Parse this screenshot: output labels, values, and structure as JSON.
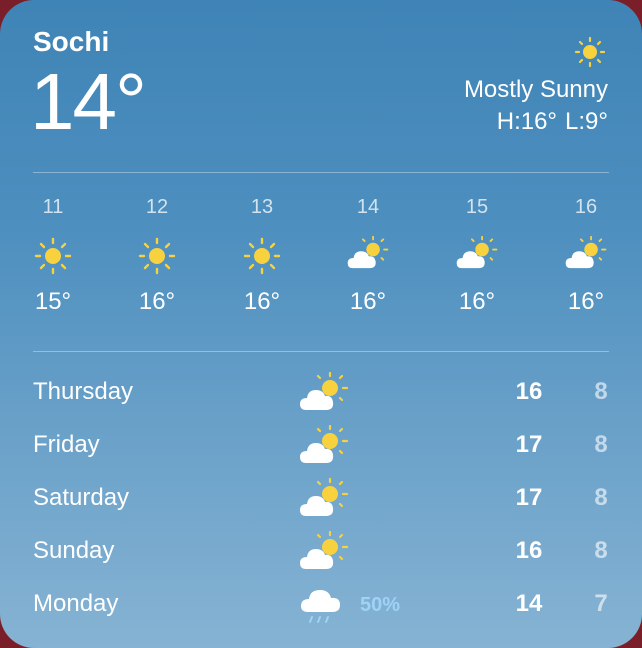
{
  "city": "Sochi",
  "current_temp": "14°",
  "condition": "Mostly Sunny",
  "high": "H:16°",
  "low": "L:9°",
  "current_icon": "sun-icon",
  "hourly": [
    {
      "hour": "11",
      "icon": "sun-icon",
      "temp": "15°"
    },
    {
      "hour": "12",
      "icon": "sun-icon",
      "temp": "16°"
    },
    {
      "hour": "13",
      "icon": "sun-icon",
      "temp": "16°"
    },
    {
      "hour": "14",
      "icon": "partly-cloudy-icon",
      "temp": "16°"
    },
    {
      "hour": "15",
      "icon": "partly-cloudy-icon",
      "temp": "16°"
    },
    {
      "hour": "16",
      "icon": "partly-cloudy-icon",
      "temp": "16°"
    }
  ],
  "daily": [
    {
      "day": "Thursday",
      "icon": "partly-cloudy-icon",
      "precip": "",
      "high": "16",
      "low": "8"
    },
    {
      "day": "Friday",
      "icon": "partly-cloudy-icon",
      "precip": "",
      "high": "17",
      "low": "8"
    },
    {
      "day": "Saturday",
      "icon": "partly-cloudy-icon",
      "precip": "",
      "high": "17",
      "low": "8"
    },
    {
      "day": "Sunday",
      "icon": "partly-cloudy-icon",
      "precip": "",
      "high": "16",
      "low": "8"
    },
    {
      "day": "Monday",
      "icon": "rain-icon",
      "precip": "50%",
      "high": "14",
      "low": "7"
    }
  ],
  "colors": {
    "sun": "#f7d23e",
    "cloud": "#ffffff",
    "precip": "#9ed3f5",
    "bg_top": "#3f84b6",
    "bg_bottom": "#86b3d3"
  }
}
